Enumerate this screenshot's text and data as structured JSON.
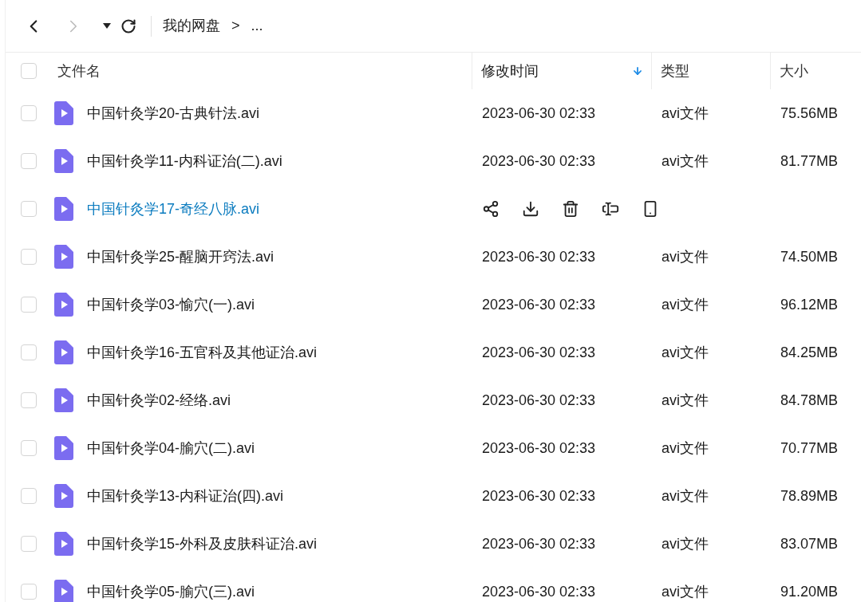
{
  "toolbar": {
    "back_disabled": false,
    "forward_disabled": true,
    "breadcrumb": [
      "我的网盘",
      "..."
    ],
    "separator": ">"
  },
  "table": {
    "select_all_checked": false,
    "columns": [
      {
        "label": "文件名",
        "sorted": false
      },
      {
        "label": "修改时间",
        "sorted": true
      },
      {
        "label": "类型",
        "sorted": false
      },
      {
        "label": "大小",
        "sorted": false
      }
    ],
    "rows": [
      {
        "name": "中国针灸学20-古典针法.avi",
        "modified": "2023-06-30 02:33",
        "type": "avi文件",
        "size": "75.56MB",
        "checked": false,
        "hovered": false
      },
      {
        "name": "中国针灸学11-内科证治(二).avi",
        "modified": "2023-06-30 02:33",
        "type": "avi文件",
        "size": "81.77MB",
        "checked": false,
        "hovered": false
      },
      {
        "name": "中国针灸学17-奇经八脉.avi",
        "checked": false,
        "hovered": true
      },
      {
        "name": "中国针灸学25-醒脑开窍法.avi",
        "modified": "2023-06-30 02:33",
        "type": "avi文件",
        "size": "74.50MB",
        "checked": false,
        "hovered": false
      },
      {
        "name": "中国针灸学03-愉穴(一).avi",
        "modified": "2023-06-30 02:33",
        "type": "avi文件",
        "size": "96.12MB",
        "checked": false,
        "hovered": false
      },
      {
        "name": "中国针灸学16-五官科及其他证治.avi",
        "modified": "2023-06-30 02:33",
        "type": "avi文件",
        "size": "84.25MB",
        "checked": false,
        "hovered": false
      },
      {
        "name": "中国针灸学02-经络.avi",
        "modified": "2023-06-30 02:33",
        "type": "avi文件",
        "size": "84.78MB",
        "checked": false,
        "hovered": false
      },
      {
        "name": "中国针灸学04-腧穴(二).avi",
        "modified": "2023-06-30 02:33",
        "type": "avi文件",
        "size": "70.77MB",
        "checked": false,
        "hovered": false
      },
      {
        "name": "中国针灸学13-内科证治(四).avi",
        "modified": "2023-06-30 02:33",
        "type": "avi文件",
        "size": "78.89MB",
        "checked": false,
        "hovered": false
      },
      {
        "name": "中国针灸学15-外科及皮肤科证治.avi",
        "modified": "2023-06-30 02:33",
        "type": "avi文件",
        "size": "83.07MB",
        "checked": false,
        "hovered": false
      },
      {
        "name": "中国针灸学05-腧穴(三).avi",
        "modified": "2023-06-30 02:33",
        "type": "avi文件",
        "size": "91.20MB",
        "checked": false,
        "hovered": false
      }
    ]
  }
}
